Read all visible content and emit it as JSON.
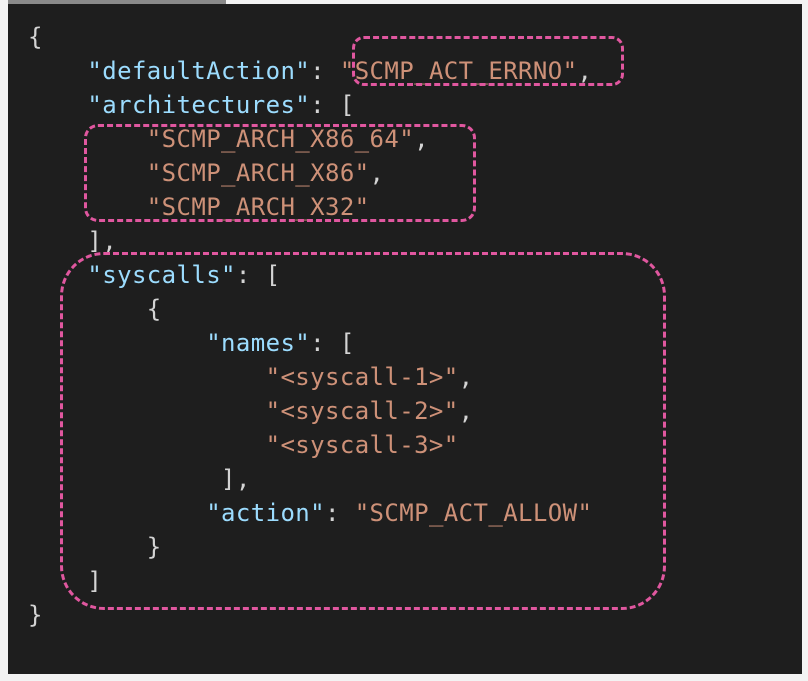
{
  "code": {
    "open_brace": "{",
    "default_action_key": "\"defaultAction\"",
    "default_action_value": "\"SCMP_ACT_ERRNO\"",
    "architectures_key": "\"architectures\"",
    "architectures": [
      "\"SCMP_ARCH_X86_64\"",
      "\"SCMP_ARCH_X86\"",
      "\"SCMP_ARCH_X32\""
    ],
    "architectures_close": "],",
    "syscalls_key": "\"syscalls\"",
    "syscall_obj_open": "{",
    "names_key": "\"names\"",
    "names": [
      "\"<syscall-1>\"",
      "\"<syscall-2>\"",
      "\"<syscall-3>\""
    ],
    "names_close": "],",
    "action_key": "\"action\"",
    "action_value": "\"SCMP_ACT_ALLOW\"",
    "syscall_obj_close": "}",
    "syscalls_close": "]",
    "close_brace": "}"
  },
  "colors": {
    "background": "#1e1e1e",
    "key": "#9cdcfe",
    "string": "#ce9178",
    "punctuation": "#d4d4d4",
    "highlight": "#e0579f"
  }
}
